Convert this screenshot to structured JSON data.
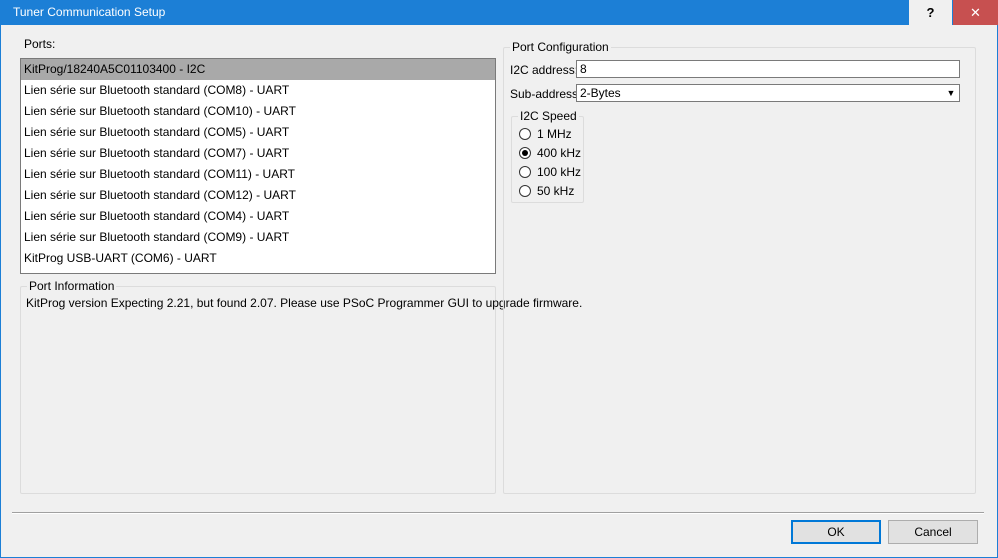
{
  "window": {
    "title": "Tuner Communication Setup",
    "help_label": "?",
    "close_label": "✕"
  },
  "ports": {
    "label": "Ports:",
    "items": [
      "KitProg/18240A5C01103400 - I2C",
      "Lien série sur Bluetooth standard (COM8) - UART",
      "Lien série sur Bluetooth standard (COM10) - UART",
      "Lien série sur Bluetooth standard (COM5) - UART",
      "Lien série sur Bluetooth standard (COM7) - UART",
      "Lien série sur Bluetooth standard (COM11) - UART",
      "Lien série sur Bluetooth standard (COM12) - UART",
      "Lien série sur Bluetooth standard (COM4) - UART",
      "Lien série sur Bluetooth standard (COM9) - UART",
      "KitProg USB-UART (COM6) - UART"
    ],
    "selected_index": 0
  },
  "port_information": {
    "title": "Port Information",
    "text": "KitProg version Expecting 2.21, but found 2.07. Please use PSoC Programmer GUI to upgrade firmware."
  },
  "port_configuration": {
    "title": "Port Configuration",
    "i2c_address_label": "I2C address:",
    "i2c_address_value": "8",
    "sub_address_label": "Sub-address:",
    "sub_address_value": "2-Bytes",
    "i2c_speed": {
      "title": "I2C Speed",
      "options": [
        "1 MHz",
        "400 kHz",
        "100 kHz",
        "50 kHz"
      ],
      "selected_index": 1
    }
  },
  "buttons": {
    "ok": "OK",
    "cancel": "Cancel"
  }
}
